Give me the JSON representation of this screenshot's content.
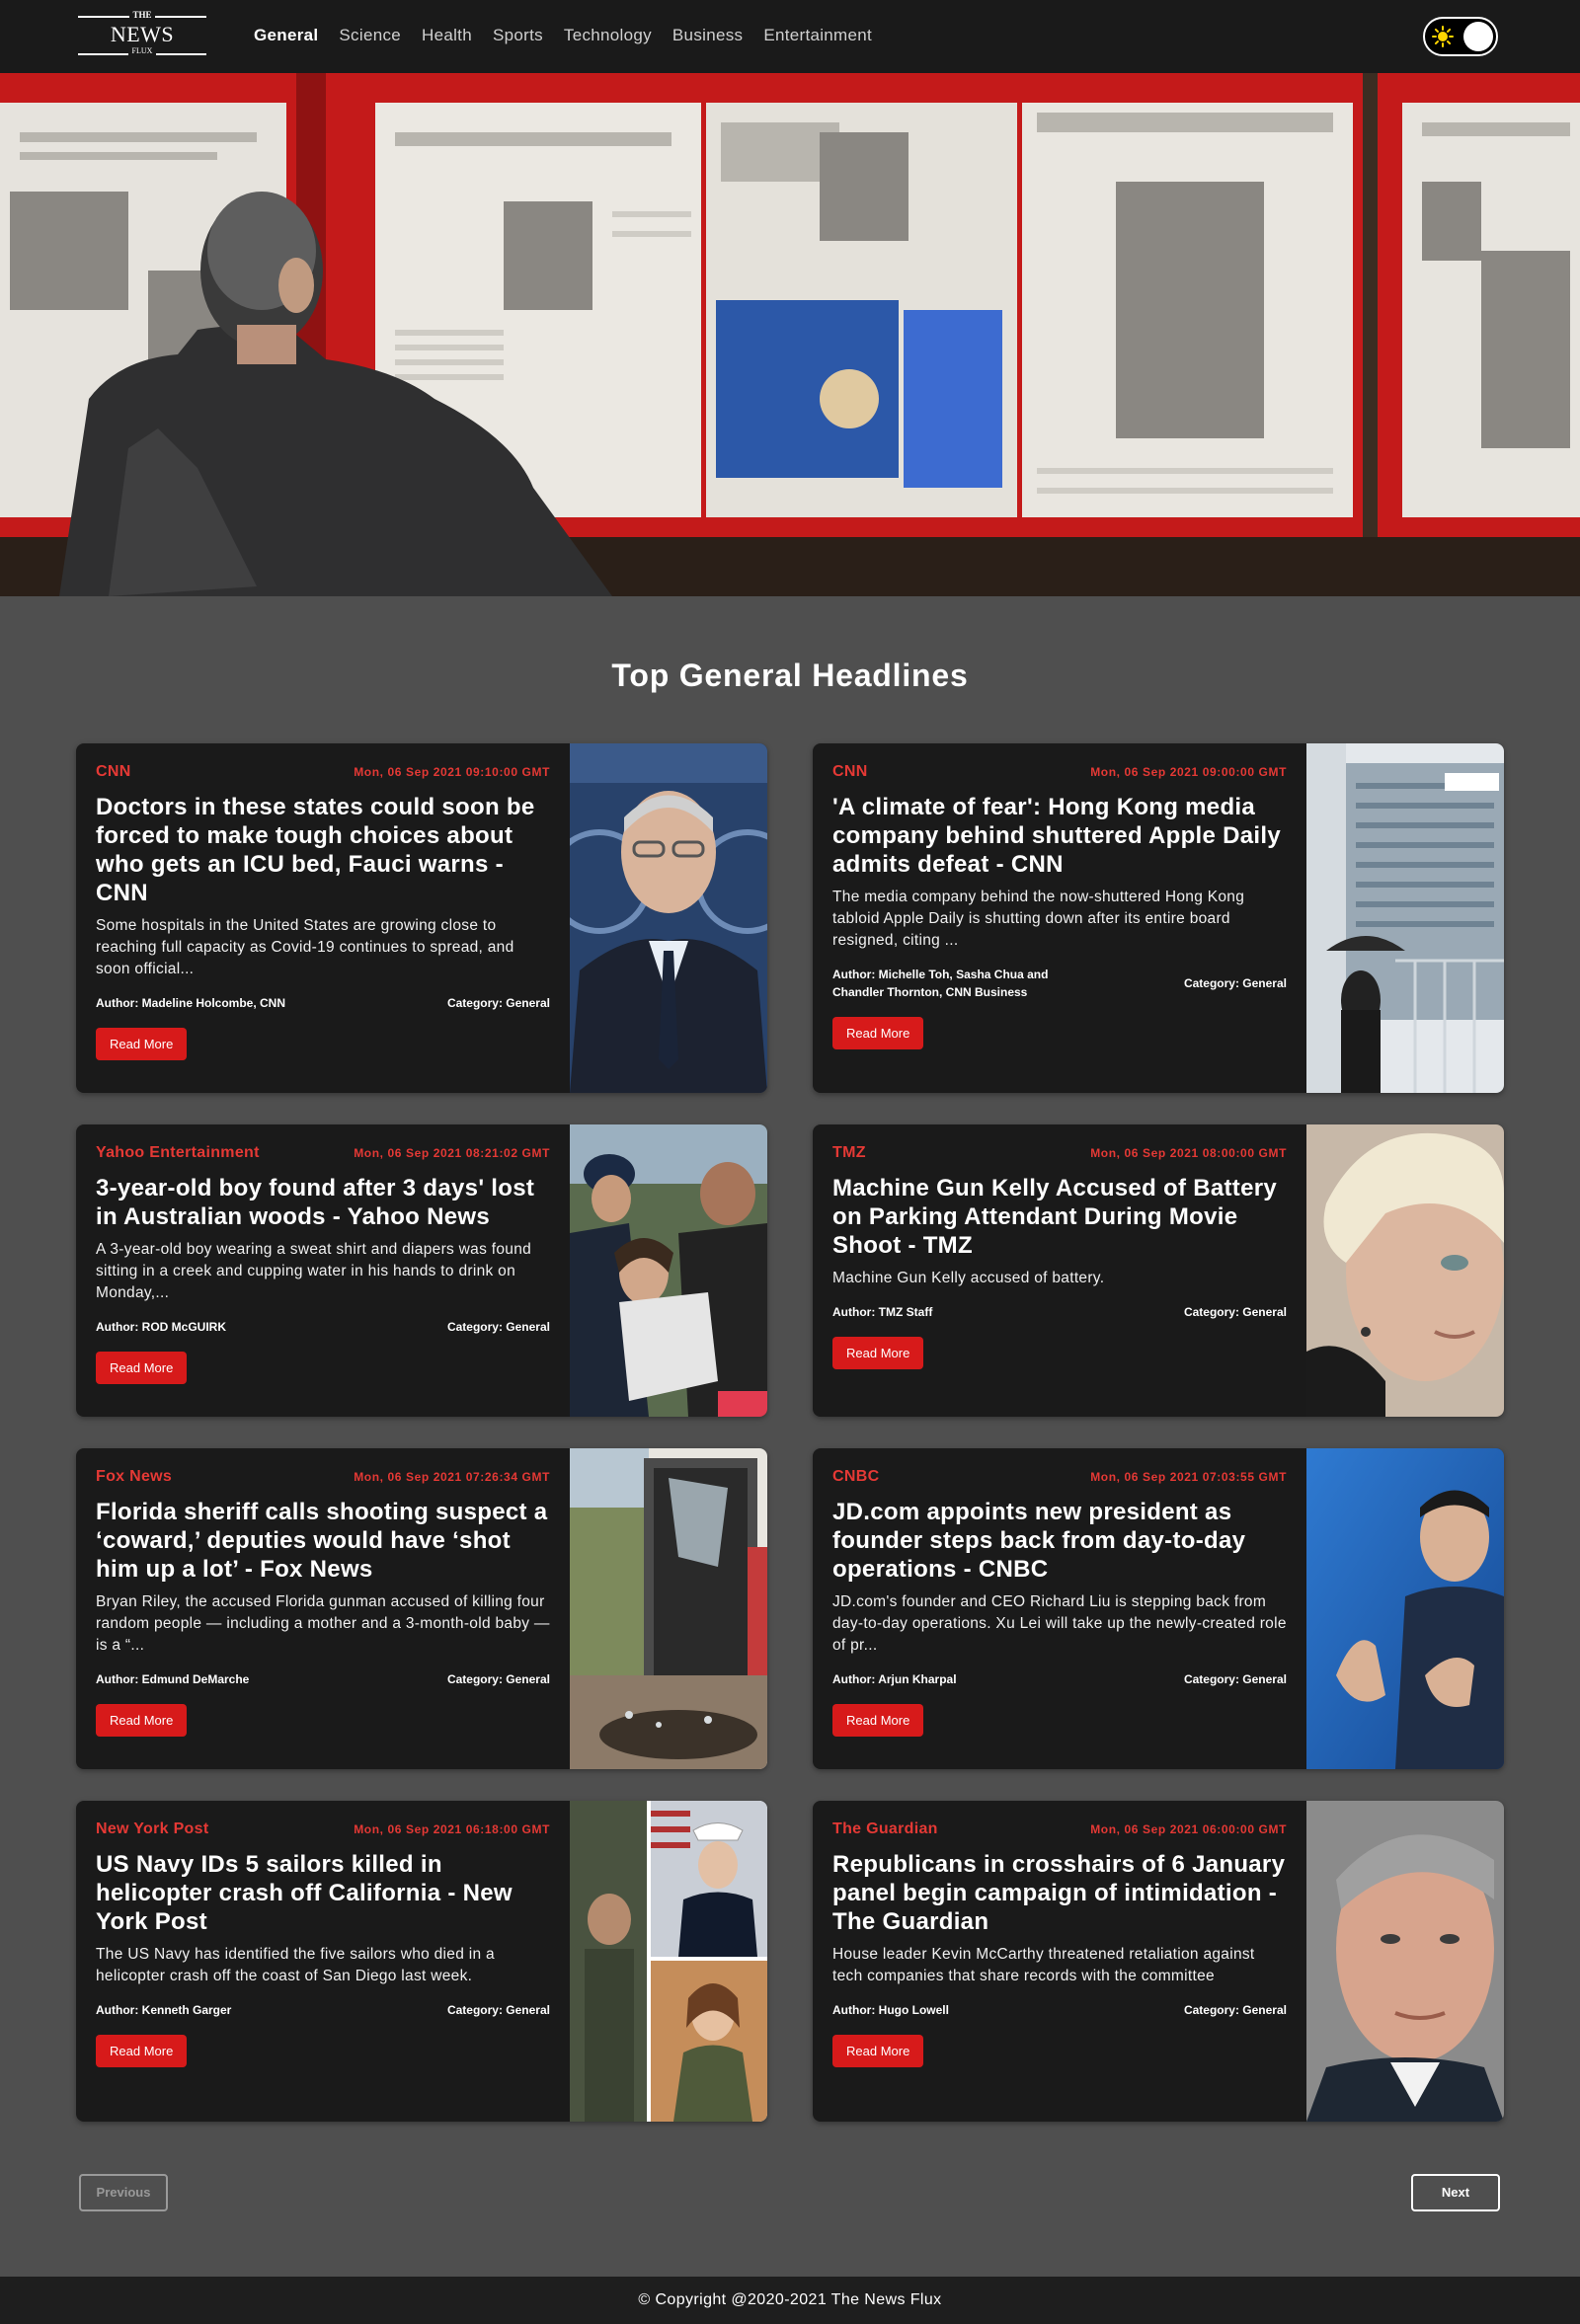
{
  "brand": {
    "top": "THE",
    "main": "NEWS",
    "bottom": "FLUX"
  },
  "nav": {
    "items": [
      {
        "label": "General",
        "active": true
      },
      {
        "label": "Science"
      },
      {
        "label": "Health"
      },
      {
        "label": "Sports"
      },
      {
        "label": "Technology"
      },
      {
        "label": "Business"
      },
      {
        "label": "Entertainment"
      }
    ],
    "theme_toggle": {
      "icon": "sun-icon",
      "state": "dark"
    }
  },
  "hero": {
    "image": "man-reading-newspapers-photo"
  },
  "section_title": "Top General Headlines",
  "articles": [
    {
      "source": "CNN",
      "date": "Mon, 06 Sep 2021 09:10:00 GMT",
      "title": "Doctors in these states could soon be forced to make tough choices about who gets an ICU bed, Fauci warns - CNN",
      "description": "Some hospitals in the United States are growing close to reaching full capacity as Covid-19 continues to spread, and soon official...",
      "author": "Author: Madeline Holcombe, CNN",
      "category": "Category: General",
      "button": "Read More",
      "image": "fauci-portrait"
    },
    {
      "source": "CNN",
      "date": "Mon, 06 Sep 2021 09:00:00 GMT",
      "title": "'A climate of fear': Hong Kong media company behind shuttered Apple Daily admits defeat - CNN",
      "description": "The media company behind the now-shuttered Hong Kong tabloid Apple Daily is shutting down after its entire board resigned, citing ...",
      "author": "Author: Michelle Toh, Sasha Chua and Chandler Thornton, CNN Business",
      "category": "Category: General",
      "button": "Read More",
      "image": "office-building-umbrella"
    },
    {
      "source": "Yahoo Entertainment",
      "date": "Mon, 06 Sep 2021 08:21:02 GMT",
      "title": "3-year-old boy found after 3 days' lost in Australian woods - Yahoo News",
      "description": "A 3-year-old boy wearing a sweat shirt and diapers was found sitting in a creek and cupping water in his hands to drink on Monday,...",
      "author": "Author: ROD McGUIRK",
      "category": "Category: General",
      "button": "Read More",
      "image": "family-embrace-police"
    },
    {
      "source": "TMZ",
      "date": "Mon, 06 Sep 2021 08:00:00 GMT",
      "title": "Machine Gun Kelly Accused of Battery on Parking Attendant During Movie Shoot - TMZ",
      "description": "Machine Gun Kelly accused of battery.",
      "author": "Author: TMZ Staff",
      "category": "Category: General",
      "button": "Read More",
      "image": "blond-man-closeup"
    },
    {
      "source": "Fox News",
      "date": "Mon, 06 Sep 2021 07:26:34 GMT",
      "title": "Florida sheriff calls shooting suspect a ‘coward,’ deputies would have ‘shot him up a lot’ - Fox News",
      "description": "Bryan Riley, the accused Florida gunman accused of killing four random people — including a mother and a 3-month-old baby — is a “...",
      "author": "Author: Edmund DeMarche",
      "category": "Category: General",
      "button": "Read More",
      "image": "broken-window"
    },
    {
      "source": "CNBC",
      "date": "Mon, 06 Sep 2021 07:03:55 GMT",
      "title": "JD.com appoints new president as founder steps back from day-to-day operations - CNBC",
      "description": "JD.com's founder and CEO Richard Liu is stepping back from day-to-day operations. Xu Lei will take up the newly-created role of pr...",
      "author": "Author: Arjun Kharpal",
      "category": "Category: General",
      "button": "Read More",
      "image": "speaker-gesturing"
    },
    {
      "source": "New York Post",
      "date": "Mon, 06 Sep 2021 06:18:00 GMT",
      "title": "US Navy IDs 5 sailors killed in helicopter crash off California - New York Post",
      "description": "The US Navy has identified the five sailors who died in a helicopter crash off the coast of San Diego last week.",
      "author": "Author: Kenneth Garger",
      "category": "Category: General",
      "button": "Read More",
      "image": "sailor-portraits"
    },
    {
      "source": "The Guardian",
      "date": "Mon, 06 Sep 2021 06:00:00 GMT",
      "title": "Republicans in crosshairs of 6 January panel begin campaign of intimidation - The Guardian",
      "description": "House leader Kevin McCarthy threatened retaliation against tech companies that share records with the committee",
      "author": "Author: Hugo Lowell",
      "category": "Category: General",
      "button": "Read More",
      "image": "politician-portrait"
    }
  ],
  "pagination": {
    "prev": "Previous",
    "next": "Next",
    "prev_disabled": true
  },
  "footer": "© Copyright @2020-2021 The News Flux"
}
